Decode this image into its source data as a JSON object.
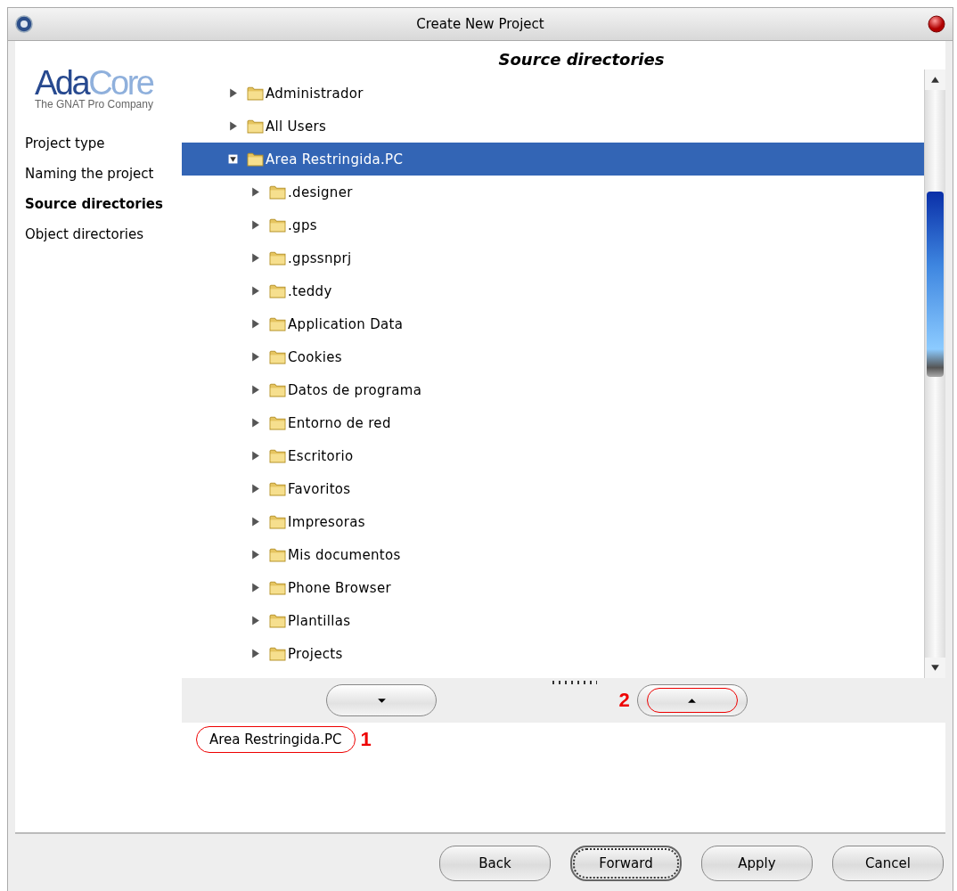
{
  "window": {
    "title": "Create New Project"
  },
  "logo": {
    "primary": "Ada",
    "secondary": "Core",
    "tagline": "The GNAT Pro Company"
  },
  "steps": [
    {
      "label": "Project type",
      "selected": false
    },
    {
      "label": "Naming the project",
      "selected": false
    },
    {
      "label": "Source directories",
      "selected": true
    },
    {
      "label": "Object directories",
      "selected": false
    }
  ],
  "page_title": "Source directories",
  "tree": [
    {
      "label": "Administrador",
      "expanded": false,
      "selected": false
    },
    {
      "label": "All Users",
      "expanded": false,
      "selected": false
    },
    {
      "label": "Area Restringida.PC",
      "expanded": true,
      "selected": true,
      "children": [
        {
          "label": ".designer",
          "expanded": false,
          "selected": false
        },
        {
          "label": ".gps",
          "expanded": false,
          "selected": false
        },
        {
          "label": ".gpssnprj",
          "expanded": false,
          "selected": false
        },
        {
          "label": ".teddy",
          "expanded": false,
          "selected": false
        },
        {
          "label": "Application Data",
          "expanded": false,
          "selected": false
        },
        {
          "label": "Cookies",
          "expanded": false,
          "selected": false
        },
        {
          "label": "Datos de programa",
          "expanded": false,
          "selected": false
        },
        {
          "label": "Entorno de red",
          "expanded": false,
          "selected": false
        },
        {
          "label": "Escritorio",
          "expanded": false,
          "selected": false
        },
        {
          "label": "Favoritos",
          "expanded": false,
          "selected": false
        },
        {
          "label": "Impresoras",
          "expanded": false,
          "selected": false
        },
        {
          "label": "Mis documentos",
          "expanded": false,
          "selected": false
        },
        {
          "label": "Phone Browser",
          "expanded": false,
          "selected": false
        },
        {
          "label": "Plantillas",
          "expanded": false,
          "selected": false
        },
        {
          "label": "Projects",
          "expanded": false,
          "selected": false
        }
      ]
    }
  ],
  "move_buttons": [
    {
      "kind": "down"
    },
    {
      "kind": "up",
      "callout": "2"
    }
  ],
  "selected_dirs": [
    {
      "label": "Area Restringida.PC",
      "callout": "1"
    }
  ],
  "buttons": [
    {
      "label": "Back",
      "focused": false
    },
    {
      "label": "Forward",
      "focused": true
    },
    {
      "label": "Apply",
      "focused": false
    },
    {
      "label": "Cancel",
      "focused": false
    }
  ]
}
